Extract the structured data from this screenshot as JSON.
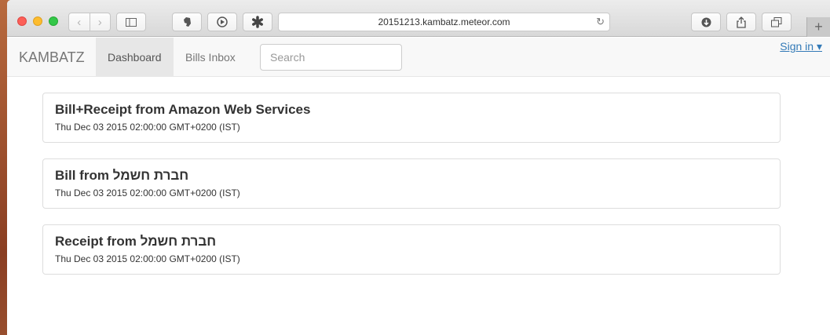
{
  "browser": {
    "url": "20151213.kambatz.meteor.com",
    "new_tab_label": "+"
  },
  "navbar": {
    "brand": "KAMBATZ",
    "tabs": [
      "Dashboard",
      "Bills Inbox"
    ],
    "search_placeholder": "Search",
    "signin": "Sign in ▾"
  },
  "items": [
    {
      "title": "Bill+Receipt from Amazon Web Services",
      "date": "Thu Dec 03 2015 02:00:00 GMT+0200 (IST)"
    },
    {
      "title": "Bill from חברת חשמל",
      "date": "Thu Dec 03 2015 02:00:00 GMT+0200 (IST)"
    },
    {
      "title": "Receipt from חברת חשמל",
      "date": "Thu Dec 03 2015 02:00:00 GMT+0200 (IST)"
    }
  ]
}
